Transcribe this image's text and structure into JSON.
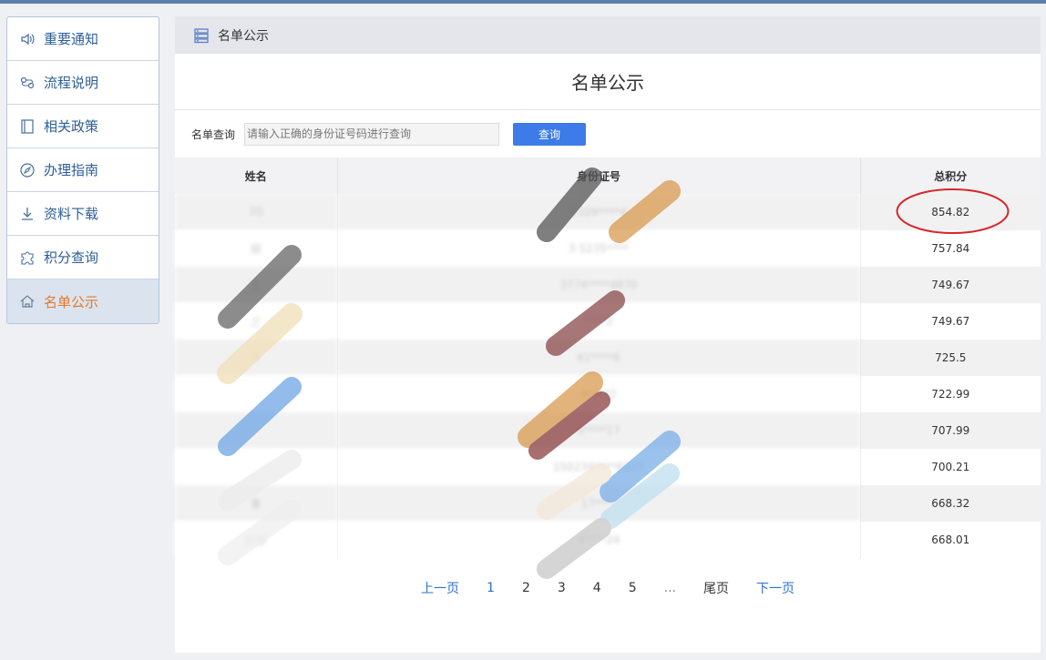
{
  "sidebar": {
    "items": [
      {
        "label": "重要通知",
        "icon": "speaker-icon"
      },
      {
        "label": "流程说明",
        "icon": "flow-icon"
      },
      {
        "label": "相关政策",
        "icon": "book-icon"
      },
      {
        "label": "办理指南",
        "icon": "compass-icon"
      },
      {
        "label": "资料下载",
        "icon": "download-icon"
      },
      {
        "label": "积分查询",
        "icon": "puzzle-icon"
      },
      {
        "label": "名单公示",
        "icon": "home-icon",
        "active": true
      }
    ]
  },
  "header": {
    "title": "名单公示"
  },
  "page": {
    "title": "名单公示"
  },
  "search": {
    "label": "名单查询",
    "placeholder": "请输入正确的身份证号码进行查询",
    "button": "查询"
  },
  "table": {
    "headers": [
      "姓名",
      "身份证号",
      "总积分"
    ],
    "rows": [
      {
        "name": "70",
        "id": "1329****4",
        "score": "854.82"
      },
      {
        "name": "郑",
        "id": "3 5235****",
        "score": "757.84"
      },
      {
        "name": "王",
        "id": "3774****4870",
        "score": "749.67"
      },
      {
        "name": "三",
        "id": "****2",
        "score": "749.67"
      },
      {
        "name": "X",
        "id": "61****6",
        "score": "725.5"
      },
      {
        "name": "",
        "id": "4****2",
        "score": "722.99"
      },
      {
        "name": "",
        "id": "5****17",
        "score": "707.99"
      },
      {
        "name": "",
        "id": "150234****6527",
        "score": "700.21"
      },
      {
        "name": "李",
        "id": "17****",
        "score": "668.32"
      },
      {
        "name": "刘李",
        "id": "4****24",
        "score": "668.01"
      }
    ]
  },
  "pagination": {
    "prev": "上一页",
    "pages": [
      "1",
      "2",
      "3",
      "4",
      "5"
    ],
    "ellipsis": "...",
    "last": "尾页",
    "next": "下一页"
  },
  "colors": {
    "accent": "#3d7ce8",
    "active": "#e8772e",
    "annotation": "#d7262b"
  }
}
